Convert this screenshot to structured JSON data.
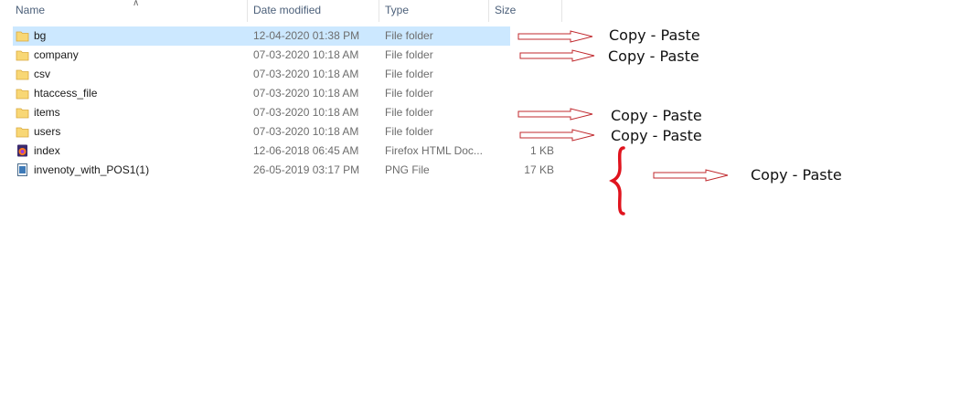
{
  "columns": {
    "name": "Name",
    "date": "Date modified",
    "type": "Type",
    "size": "Size"
  },
  "files": [
    {
      "name": "bg",
      "date": "12-04-2020 01:38 PM",
      "type": "File folder",
      "size": "",
      "icon": "folder-icon",
      "selected": true
    },
    {
      "name": "company",
      "date": "07-03-2020 10:18 AM",
      "type": "File folder",
      "size": "",
      "icon": "folder-icon"
    },
    {
      "name": "csv",
      "date": "07-03-2020 10:18 AM",
      "type": "File folder",
      "size": "",
      "icon": "folder-icon"
    },
    {
      "name": "htaccess_file",
      "date": "07-03-2020 10:18 AM",
      "type": "File folder",
      "size": "",
      "icon": "folder-icon"
    },
    {
      "name": "items",
      "date": "07-03-2020 10:18 AM",
      "type": "File folder",
      "size": "",
      "icon": "folder-icon"
    },
    {
      "name": "users",
      "date": "07-03-2020 10:18 AM",
      "type": "File folder",
      "size": "",
      "icon": "folder-icon"
    },
    {
      "name": "index",
      "date": "12-06-2018 06:45 AM",
      "type": "Firefox HTML Doc...",
      "size": "1 KB",
      "icon": "firefox-html-icon"
    },
    {
      "name": "invenoty_with_POS1(1)",
      "date": "26-05-2019 03:17 PM",
      "type": "PNG File",
      "size": "17 KB",
      "icon": "png-file-icon"
    }
  ],
  "annotations": [
    {
      "text": "Copy - Paste"
    },
    {
      "text": "Copy - Paste"
    },
    {
      "text": "Copy - Paste"
    },
    {
      "text": "Copy - Paste"
    },
    {
      "text": "Copy - Paste"
    }
  ],
  "colors": {
    "selected_row": "#cce8ff",
    "folder": "#f8d775",
    "annotation_arrow": "#c0282d",
    "brace": "#e0141e"
  }
}
